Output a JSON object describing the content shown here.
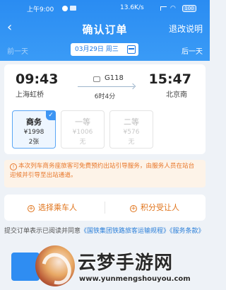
{
  "status_bar": {
    "time": "上午9:00",
    "net_speed": "13.6K/s",
    "battery": "100"
  },
  "header": {
    "title": "确认订单",
    "refund_label": "退改说明",
    "prev_day": "前一天",
    "next_day": "后一天",
    "date": "03月29日 周三"
  },
  "trip": {
    "departure_time": "09:43",
    "departure_station": "上海虹桥",
    "train_no": "G118",
    "duration": "6时4分",
    "arrival_time": "15:47",
    "arrival_station": "北京南"
  },
  "seats": [
    {
      "name": "商务",
      "price": "¥1998",
      "count": "2张",
      "selected": true
    },
    {
      "name": "一等",
      "price": "¥1006",
      "count": "无",
      "selected": false
    },
    {
      "name": "二等",
      "price": "¥576",
      "count": "无",
      "selected": false
    }
  ],
  "notice": "本次列车商务座旅客可免费预约出站引导服务，由服务人员在站台迎候并引导至出站通道。",
  "actions": {
    "select_passenger": "选择乘车人",
    "points_receiver": "积分受让人"
  },
  "agreement": {
    "prefix": "提交订单表示已阅读并同意",
    "link1": "《国铁集团铁路旅客运输规程》",
    "link2": "《服务条款》"
  },
  "watermark": {
    "title": "云梦手游网",
    "url": "www.yunmengshouyou.com"
  },
  "colors": {
    "header_blue": "#2a8cf2",
    "accent_orange": "#e0731a",
    "link_blue": "#2b7fd9"
  }
}
